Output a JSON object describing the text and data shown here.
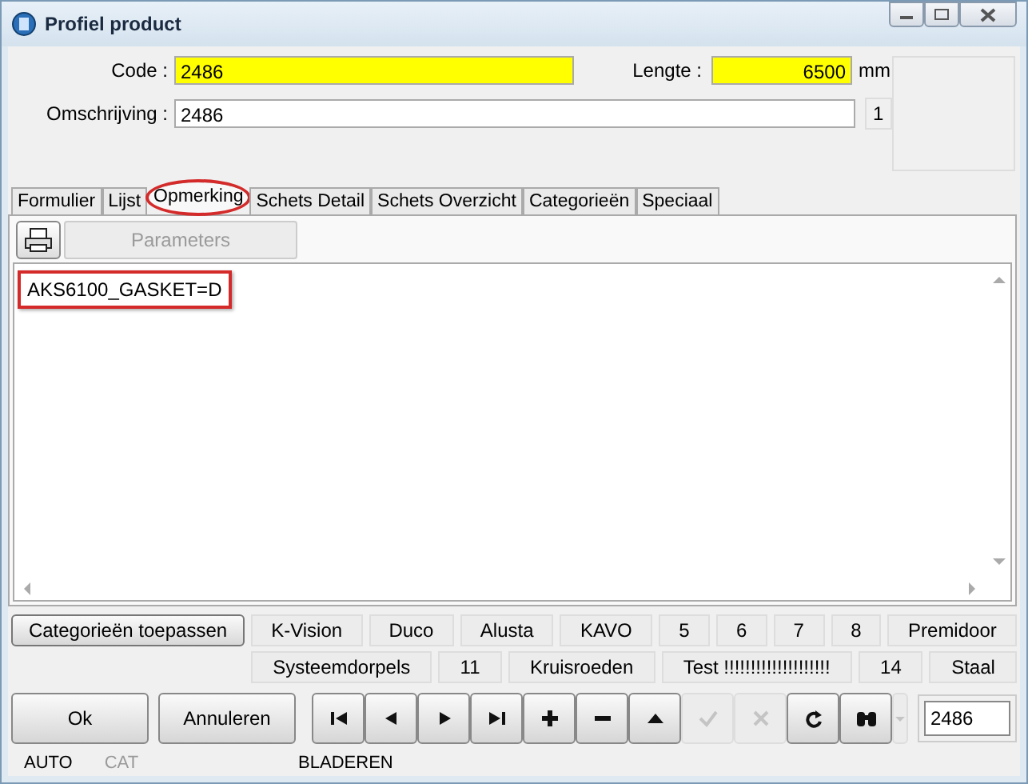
{
  "window": {
    "title": "Profiel product"
  },
  "fields": {
    "code_label": "Code :",
    "code": "2486",
    "length_label": "Lengte :",
    "length": "6500",
    "length_unit": "mm",
    "description_label": "Omschrijving :",
    "description": "2486",
    "counter": "1"
  },
  "tabs": [
    {
      "label": "Formulier",
      "selected": false,
      "circled": false
    },
    {
      "label": "Lijst",
      "selected": false,
      "circled": false
    },
    {
      "label": "Opmerking",
      "selected": true,
      "circled": true
    },
    {
      "label": "Schets Detail",
      "selected": false,
      "circled": false
    },
    {
      "label": "Schets Overzicht",
      "selected": false,
      "circled": false
    },
    {
      "label": "Categorieën",
      "selected": false,
      "circled": false
    },
    {
      "label": "Speciaal",
      "selected": false,
      "circled": false
    }
  ],
  "toolbar": {
    "parameters_button": {
      "label": "Parameters",
      "disabled": true
    }
  },
  "remark": {
    "text": "AKS6100_GASKET=D",
    "highlighted": true
  },
  "apply_button": "Categorieën toepassen",
  "category_rows": [
    [
      "K-Vision",
      "Duco",
      "Alusta",
      "KAVO",
      "5",
      "6",
      "7",
      "8",
      "Premidoor"
    ],
    [
      "Systeemdorpels",
      "11",
      "Kruisroeden",
      "Test !!!!!!!!!!!!!!!!!!!!",
      "14",
      "Staal"
    ]
  ],
  "buttons": [
    {
      "label": "Ok"
    },
    {
      "label": "Annuleren"
    }
  ],
  "nav_buttons": [
    {
      "kind": "first",
      "disabled": false
    },
    {
      "kind": "previous",
      "disabled": false
    },
    {
      "kind": "next",
      "disabled": false
    },
    {
      "kind": "last",
      "disabled": false
    },
    {
      "kind": "add",
      "disabled": false
    },
    {
      "kind": "remove",
      "disabled": false
    },
    {
      "kind": "up",
      "disabled": false
    },
    {
      "kind": "confirm",
      "disabled": true
    },
    {
      "kind": "cancel",
      "disabled": true
    },
    {
      "kind": "refresh",
      "disabled": false
    },
    {
      "kind": "find",
      "disabled": false
    },
    {
      "kind": "dropdown",
      "disabled": true
    }
  ],
  "record_field": "2486",
  "status_bar": [
    {
      "text": "AUTO",
      "disabled": false
    },
    {
      "text": "CAT",
      "disabled": true
    },
    {
      "text": "BLADEREN",
      "disabled": false
    }
  ]
}
